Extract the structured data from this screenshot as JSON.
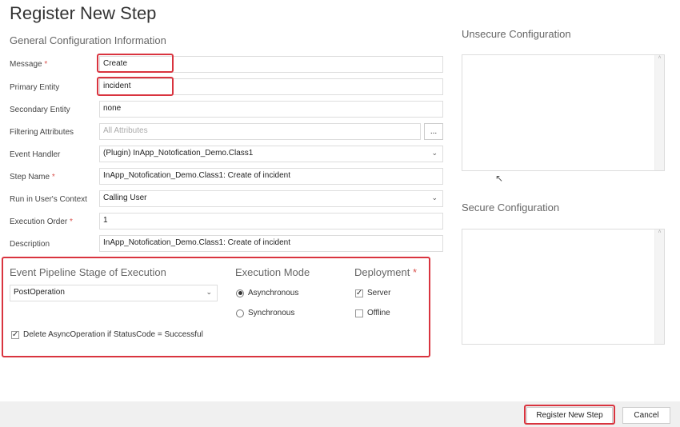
{
  "title": "Register New Step",
  "general_heading": "General Configuration Information",
  "fields": [
    {
      "label": "Message",
      "required": "*",
      "value": "Create"
    },
    {
      "label": "Primary Entity",
      "value": "incident"
    },
    {
      "label": "Secondary Entity",
      "value": "none"
    },
    {
      "label": "Filtering Attributes",
      "placeholder": "All Attributes",
      "button": "..."
    },
    {
      "label": "Event Handler",
      "value": "(Plugin) InApp_Notofication_Demo.Class1"
    },
    {
      "label": "Step Name",
      "required": "*",
      "value": "InApp_Notofication_Demo.Class1: Create of incident"
    },
    {
      "label": "Run in User's Context",
      "value": "Calling User"
    },
    {
      "label": "Execution Order",
      "required": "*",
      "value": "1"
    },
    {
      "label": "Description",
      "value": "InApp_Notofication_Demo.Class1: Create of incident"
    }
  ],
  "pipeline": {
    "label": "Event Pipeline Stage of Execution",
    "value": "PostOperation"
  },
  "mode": {
    "label": "Execution Mode",
    "options": [
      "Asynchronous",
      "Synchronous"
    ],
    "selected": "Asynchronous"
  },
  "deployment": {
    "label": "Deployment",
    "required": "*",
    "options": [
      {
        "label": "Server",
        "checked": true
      },
      {
        "label": "Offline",
        "checked": false
      }
    ]
  },
  "delete_async": {
    "label": "Delete AsyncOperation if StatusCode = Successful",
    "checked": true
  },
  "unsecure_label": "Unsecure  Configuration",
  "secure_label": "Secure  Configuration",
  "buttons": {
    "register": "Register New Step",
    "cancel": "Cancel"
  }
}
